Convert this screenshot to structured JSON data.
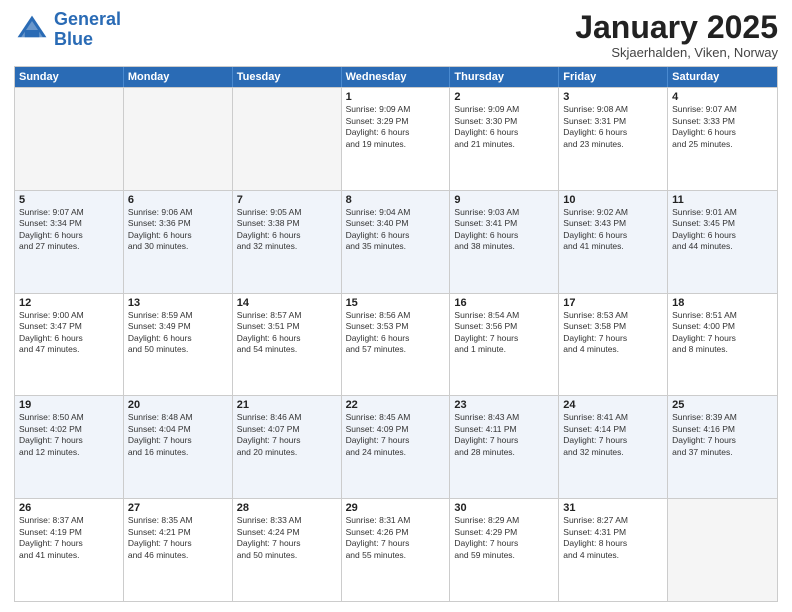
{
  "header": {
    "logo_line1": "General",
    "logo_line2": "Blue",
    "title": "January 2025",
    "subtitle": "Skjaerhalden, Viken, Norway"
  },
  "calendar": {
    "days_of_week": [
      "Sunday",
      "Monday",
      "Tuesday",
      "Wednesday",
      "Thursday",
      "Friday",
      "Saturday"
    ],
    "rows": [
      [
        {
          "day": "",
          "info": "",
          "empty": true
        },
        {
          "day": "",
          "info": "",
          "empty": true
        },
        {
          "day": "",
          "info": "",
          "empty": true
        },
        {
          "day": "1",
          "info": "Sunrise: 9:09 AM\nSunset: 3:29 PM\nDaylight: 6 hours\nand 19 minutes.",
          "empty": false
        },
        {
          "day": "2",
          "info": "Sunrise: 9:09 AM\nSunset: 3:30 PM\nDaylight: 6 hours\nand 21 minutes.",
          "empty": false
        },
        {
          "day": "3",
          "info": "Sunrise: 9:08 AM\nSunset: 3:31 PM\nDaylight: 6 hours\nand 23 minutes.",
          "empty": false
        },
        {
          "day": "4",
          "info": "Sunrise: 9:07 AM\nSunset: 3:33 PM\nDaylight: 6 hours\nand 25 minutes.",
          "empty": false
        }
      ],
      [
        {
          "day": "5",
          "info": "Sunrise: 9:07 AM\nSunset: 3:34 PM\nDaylight: 6 hours\nand 27 minutes.",
          "empty": false
        },
        {
          "day": "6",
          "info": "Sunrise: 9:06 AM\nSunset: 3:36 PM\nDaylight: 6 hours\nand 30 minutes.",
          "empty": false
        },
        {
          "day": "7",
          "info": "Sunrise: 9:05 AM\nSunset: 3:38 PM\nDaylight: 6 hours\nand 32 minutes.",
          "empty": false
        },
        {
          "day": "8",
          "info": "Sunrise: 9:04 AM\nSunset: 3:40 PM\nDaylight: 6 hours\nand 35 minutes.",
          "empty": false
        },
        {
          "day": "9",
          "info": "Sunrise: 9:03 AM\nSunset: 3:41 PM\nDaylight: 6 hours\nand 38 minutes.",
          "empty": false
        },
        {
          "day": "10",
          "info": "Sunrise: 9:02 AM\nSunset: 3:43 PM\nDaylight: 6 hours\nand 41 minutes.",
          "empty": false
        },
        {
          "day": "11",
          "info": "Sunrise: 9:01 AM\nSunset: 3:45 PM\nDaylight: 6 hours\nand 44 minutes.",
          "empty": false
        }
      ],
      [
        {
          "day": "12",
          "info": "Sunrise: 9:00 AM\nSunset: 3:47 PM\nDaylight: 6 hours\nand 47 minutes.",
          "empty": false
        },
        {
          "day": "13",
          "info": "Sunrise: 8:59 AM\nSunset: 3:49 PM\nDaylight: 6 hours\nand 50 minutes.",
          "empty": false
        },
        {
          "day": "14",
          "info": "Sunrise: 8:57 AM\nSunset: 3:51 PM\nDaylight: 6 hours\nand 54 minutes.",
          "empty": false
        },
        {
          "day": "15",
          "info": "Sunrise: 8:56 AM\nSunset: 3:53 PM\nDaylight: 6 hours\nand 57 minutes.",
          "empty": false
        },
        {
          "day": "16",
          "info": "Sunrise: 8:54 AM\nSunset: 3:56 PM\nDaylight: 7 hours\nand 1 minute.",
          "empty": false
        },
        {
          "day": "17",
          "info": "Sunrise: 8:53 AM\nSunset: 3:58 PM\nDaylight: 7 hours\nand 4 minutes.",
          "empty": false
        },
        {
          "day": "18",
          "info": "Sunrise: 8:51 AM\nSunset: 4:00 PM\nDaylight: 7 hours\nand 8 minutes.",
          "empty": false
        }
      ],
      [
        {
          "day": "19",
          "info": "Sunrise: 8:50 AM\nSunset: 4:02 PM\nDaylight: 7 hours\nand 12 minutes.",
          "empty": false
        },
        {
          "day": "20",
          "info": "Sunrise: 8:48 AM\nSunset: 4:04 PM\nDaylight: 7 hours\nand 16 minutes.",
          "empty": false
        },
        {
          "day": "21",
          "info": "Sunrise: 8:46 AM\nSunset: 4:07 PM\nDaylight: 7 hours\nand 20 minutes.",
          "empty": false
        },
        {
          "day": "22",
          "info": "Sunrise: 8:45 AM\nSunset: 4:09 PM\nDaylight: 7 hours\nand 24 minutes.",
          "empty": false
        },
        {
          "day": "23",
          "info": "Sunrise: 8:43 AM\nSunset: 4:11 PM\nDaylight: 7 hours\nand 28 minutes.",
          "empty": false
        },
        {
          "day": "24",
          "info": "Sunrise: 8:41 AM\nSunset: 4:14 PM\nDaylight: 7 hours\nand 32 minutes.",
          "empty": false
        },
        {
          "day": "25",
          "info": "Sunrise: 8:39 AM\nSunset: 4:16 PM\nDaylight: 7 hours\nand 37 minutes.",
          "empty": false
        }
      ],
      [
        {
          "day": "26",
          "info": "Sunrise: 8:37 AM\nSunset: 4:19 PM\nDaylight: 7 hours\nand 41 minutes.",
          "empty": false
        },
        {
          "day": "27",
          "info": "Sunrise: 8:35 AM\nSunset: 4:21 PM\nDaylight: 7 hours\nand 46 minutes.",
          "empty": false
        },
        {
          "day": "28",
          "info": "Sunrise: 8:33 AM\nSunset: 4:24 PM\nDaylight: 7 hours\nand 50 minutes.",
          "empty": false
        },
        {
          "day": "29",
          "info": "Sunrise: 8:31 AM\nSunset: 4:26 PM\nDaylight: 7 hours\nand 55 minutes.",
          "empty": false
        },
        {
          "day": "30",
          "info": "Sunrise: 8:29 AM\nSunset: 4:29 PM\nDaylight: 7 hours\nand 59 minutes.",
          "empty": false
        },
        {
          "day": "31",
          "info": "Sunrise: 8:27 AM\nSunset: 4:31 PM\nDaylight: 8 hours\nand 4 minutes.",
          "empty": false
        },
        {
          "day": "",
          "info": "",
          "empty": true
        }
      ]
    ]
  }
}
